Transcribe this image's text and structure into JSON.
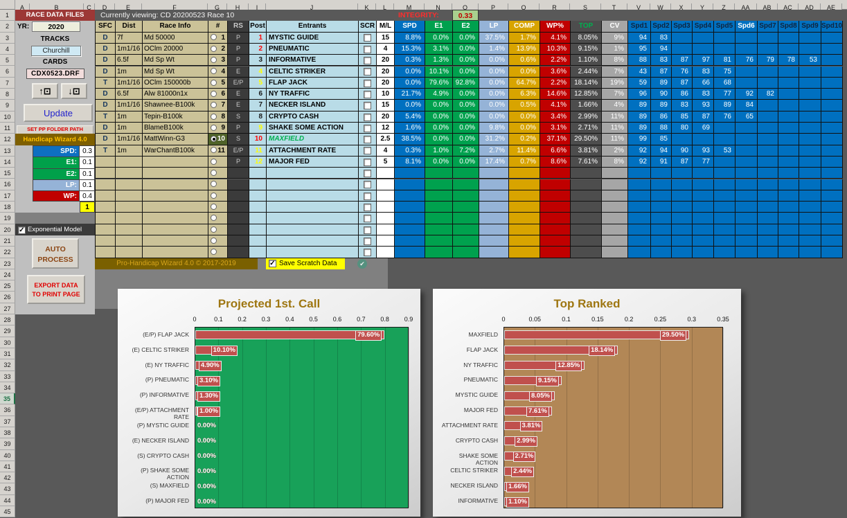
{
  "sheet": {
    "column_letters": [
      "A",
      "B",
      "C",
      "D",
      "E",
      "F",
      "G",
      "H",
      "I",
      "J",
      "K",
      "L",
      "M",
      "N",
      "O",
      "P",
      "Q",
      "R",
      "S",
      "T",
      "V",
      "W",
      "X",
      "Y",
      "Z",
      "AA",
      "AB",
      "AC",
      "AD",
      "AE"
    ],
    "row_count": 45,
    "active_row": 35
  },
  "left_panel": {
    "title": "RACE DATA FILES",
    "yr_label": "YR:",
    "yr_value": "2020",
    "tracks_label": "TRACKS",
    "track_value": "Churchill",
    "cards_label": "CARDS",
    "card_value": "CDX0523.DRF",
    "up_button": "↑⊡",
    "down_button": "↓⊡",
    "update_button": "Update",
    "set_pp_button": "SET PP FOLDER PATH",
    "wizard_title": "Handicap Wizard 4.0",
    "weights": [
      {
        "label": "SPD:",
        "value": "0.3",
        "color": "#0E6FC1"
      },
      {
        "label": "E1:",
        "value": "0.1",
        "color": "#00A04A"
      },
      {
        "label": "E2:",
        "value": "0.1",
        "color": "#00A04A"
      },
      {
        "label": "LP:",
        "value": "0.1",
        "color": "#95B3D7"
      },
      {
        "label": "WP:",
        "value": "0.4",
        "color": "#C00000"
      }
    ],
    "weights_total": "1",
    "exponential_label": "Exponential Model",
    "exponential_checked": true,
    "auto_process_line1": "AUTO",
    "auto_process_line2": "PROCESS",
    "export_line1": "EXPORT DATA",
    "export_line2": "TO PRINT PAGE"
  },
  "viewing_bar": {
    "text": "Currently viewing: CD 20200523 Race 10",
    "integrity_label": "INTEGRITY:",
    "integrity_value": "0.33"
  },
  "race_table": {
    "headers": [
      "SFC",
      "Dist",
      "Race Info",
      "#"
    ],
    "rows": [
      {
        "sfc": "D",
        "dist": "7f",
        "info": "Md 50000",
        "num": "1",
        "selected": false
      },
      {
        "sfc": "D",
        "dist": "1m1/16",
        "info": "OClm 20000",
        "num": "2",
        "selected": false
      },
      {
        "sfc": "D",
        "dist": "6.5f",
        "info": "Md Sp Wt",
        "num": "3",
        "selected": false
      },
      {
        "sfc": "D",
        "dist": "1m",
        "info": "Md Sp Wt",
        "num": "4",
        "selected": false
      },
      {
        "sfc": "T",
        "dist": "1m1/16",
        "info": "OClm 150000b",
        "num": "5",
        "selected": false
      },
      {
        "sfc": "D",
        "dist": "6.5f",
        "info": "Alw 81000n1x",
        "num": "6",
        "selected": false
      },
      {
        "sfc": "D",
        "dist": "1m1/16",
        "info": "Shawnee-B100k",
        "num": "7",
        "selected": false
      },
      {
        "sfc": "T",
        "dist": "1m",
        "info": "Tepin-B100k",
        "num": "8",
        "selected": false
      },
      {
        "sfc": "D",
        "dist": "1m",
        "info": "BlameB100k",
        "num": "9",
        "selected": false
      },
      {
        "sfc": "D",
        "dist": "1m1/16",
        "info": "MattWinn-G3",
        "num": "10",
        "selected": true
      },
      {
        "sfc": "T",
        "dist": "1m",
        "info": "WarChantB100k",
        "num": "11",
        "selected": false
      }
    ]
  },
  "entrant_table": {
    "headers": {
      "rs": "RS",
      "post": "Post",
      "name": "Entrants",
      "scr": "SCR",
      "ml": "M/L",
      "spd": "SPD",
      "e1": "E1",
      "e2": "E2",
      "lp": "LP",
      "comp": "COMP",
      "wp": "WP%",
      "top": "TOP",
      "cv": "CV"
    },
    "spd_headers": [
      "Spd1",
      "Spd2",
      "Spd3",
      "Spd4",
      "Spd5",
      "Spd6",
      "Spd7",
      "Spd8",
      "Spd9",
      "Spd10"
    ],
    "rows": [
      {
        "rs": "P",
        "post": "1",
        "post_color": "#FF0000",
        "name": "MYSTIC GUIDE",
        "ml": "15",
        "spd": "8.8%",
        "e1": "0.0%",
        "e2": "0.0%",
        "lp": "37.5%",
        "comp": "1.7%",
        "wp": "4.1%",
        "top": "8.05%",
        "cv": "9%",
        "spds": [
          "94",
          "83"
        ]
      },
      {
        "rs": "P",
        "post": "2",
        "post_color": "#FF0000",
        "name": "PNEUMATIC",
        "ml": "4",
        "spd": "15.3%",
        "e1": "3.1%",
        "e2": "0.0%",
        "lp": "1.4%",
        "comp": "13.9%",
        "wp": "10.3%",
        "top": "9.15%",
        "cv": "1%",
        "spds": [
          "95",
          "94"
        ]
      },
      {
        "rs": "P",
        "post": "3",
        "post_color": "#1A1A1A",
        "name": "INFORMATIVE",
        "ml": "20",
        "spd": "0.3%",
        "e1": "1.3%",
        "e2": "0.0%",
        "lp": "0.0%",
        "comp": "0.6%",
        "wp": "2.2%",
        "top": "1.10%",
        "cv": "8%",
        "spds": [
          "88",
          "83",
          "87",
          "97",
          "81",
          "76",
          "79",
          "78",
          "53"
        ]
      },
      {
        "rs": "E",
        "post": "4",
        "post_color": "#FFFF00",
        "name": "CELTIC STRIKER",
        "ml": "20",
        "spd": "0.0%",
        "e1": "10.1%",
        "e2": "0.0%",
        "lp": "0.0%",
        "comp": "0.0%",
        "wp": "3.6%",
        "top": "2.44%",
        "cv": "7%",
        "spds": [
          "43",
          "87",
          "76",
          "83",
          "75"
        ]
      },
      {
        "rs": "E/P",
        "post": "5",
        "post_color": "#FFFF00",
        "name": "FLAP JACK",
        "ml": "20",
        "spd": "0.0%",
        "e1": "79.6%",
        "e2": "92.8%",
        "lp": "0.0%",
        "comp": "64.7%",
        "wp": "2.2%",
        "top": "18.14%",
        "cv": "19%",
        "spds": [
          "59",
          "89",
          "87",
          "66",
          "68"
        ]
      },
      {
        "rs": "E",
        "post": "6",
        "post_color": "#1A1A1A",
        "name": "NY TRAFFIC",
        "ml": "10",
        "spd": "21.7%",
        "e1": "4.9%",
        "e2": "0.0%",
        "lp": "0.0%",
        "comp": "6.3%",
        "wp": "14.6%",
        "top": "12.85%",
        "cv": "7%",
        "spds": [
          "96",
          "90",
          "86",
          "83",
          "77",
          "92",
          "82"
        ]
      },
      {
        "rs": "E",
        "post": "7",
        "post_color": "#1A1A1A",
        "name": "NECKER ISLAND",
        "ml": "15",
        "spd": "0.0%",
        "e1": "0.0%",
        "e2": "0.0%",
        "lp": "0.0%",
        "comp": "0.5%",
        "wp": "4.1%",
        "top": "1.66%",
        "cv": "4%",
        "spds": [
          "89",
          "89",
          "83",
          "93",
          "89",
          "84"
        ]
      },
      {
        "rs": "S",
        "post": "8",
        "post_color": "#1A1A1A",
        "name": "CRYPTO CASH",
        "ml": "20",
        "spd": "5.4%",
        "e1": "0.0%",
        "e2": "0.0%",
        "lp": "0.0%",
        "comp": "0.0%",
        "wp": "3.4%",
        "top": "2.99%",
        "cv": "11%",
        "spds": [
          "89",
          "86",
          "85",
          "87",
          "76",
          "65"
        ]
      },
      {
        "rs": "P",
        "post": "9",
        "post_color": "#FFFF00",
        "name": "SHAKE SOME ACTION",
        "ml": "12",
        "spd": "1.6%",
        "e1": "0.0%",
        "e2": "0.0%",
        "lp": "9.8%",
        "comp": "0.0%",
        "wp": "3.1%",
        "top": "2.71%",
        "cv": "11%",
        "spds": [
          "89",
          "88",
          "80",
          "69"
        ]
      },
      {
        "rs": "S",
        "post": "10",
        "post_color": "#FF0000",
        "name": "MAXFIELD",
        "name_color": "#00B050",
        "name_italic": true,
        "ml": "2.5",
        "spd": "38.5%",
        "e1": "0.0%",
        "e2": "0.0%",
        "lp": "31.2%",
        "comp": "0.2%",
        "wp": "37.1%",
        "top": "29.50%",
        "cv": "11%",
        "spds": [
          "99",
          "85"
        ]
      },
      {
        "rs": "E/P",
        "post": "11",
        "post_color": "#FFFF00",
        "name": "ATTACHMENT RATE",
        "ml": "4",
        "spd": "0.3%",
        "e1": "1.0%",
        "e2": "7.2%",
        "lp": "2.7%",
        "comp": "11.4%",
        "wp": "6.6%",
        "top": "3.81%",
        "cv": "2%",
        "spds": [
          "92",
          "94",
          "90",
          "93",
          "53"
        ]
      },
      {
        "rs": "P",
        "post": "12",
        "post_color": "#FFFF00",
        "name": "MAJOR FED",
        "ml": "5",
        "spd": "8.1%",
        "e1": "0.0%",
        "e2": "0.0%",
        "lp": "17.4%",
        "comp": "0.7%",
        "wp": "8.6%",
        "top": "7.61%",
        "cv": "8%",
        "spds": [
          "92",
          "91",
          "87",
          "77"
        ]
      }
    ],
    "empty_rows": 8
  },
  "footer": {
    "brand": "Pro-Handicap Wizard 4.0 © 2017-2019",
    "save_scratch": "Save Scratch Data",
    "save_scratch_checked": true
  },
  "chart_data": [
    {
      "type": "bar",
      "orientation": "horizontal",
      "title": "Projected 1st. Call",
      "categories": [
        "(E/P) FLAP JACK",
        "(E) CELTIC STRIKER",
        "(E) NY TRAFFIC",
        "(P) PNEUMATIC",
        "(P) INFORMATIVE",
        "(E/P) ATTACHMENT RATE",
        "(P) MYSTIC GUIDE",
        "(E) NECKER ISLAND",
        "(S) CRYPTO CASH",
        "(P) SHAKE SOME ACTION",
        "(S) MAXFIELD",
        "(P) MAJOR FED"
      ],
      "values": [
        0.796,
        0.101,
        0.049,
        0.031,
        0.013,
        0.01,
        0,
        0,
        0,
        0,
        0,
        0
      ],
      "labels": [
        "79.60%",
        "10.10%",
        "4.90%",
        "3.10%",
        "1.30%",
        "1.00%",
        "0.00%",
        "0.00%",
        "0.00%",
        "0.00%",
        "0.00%",
        "0.00%"
      ],
      "xlim": [
        0,
        0.9
      ],
      "xticks": [
        "0",
        "0.1",
        "0.2",
        "0.3",
        "0.4",
        "0.5",
        "0.6",
        "0.7",
        "0.8",
        "0.9"
      ],
      "grid": true,
      "legend_position": "none",
      "plot_bg": "#18A159",
      "bar_color": "#C0504D"
    },
    {
      "type": "bar",
      "orientation": "horizontal",
      "title": "Top Ranked",
      "categories": [
        "MAXFIELD",
        "FLAP JACK",
        "NY TRAFFIC",
        "PNEUMATIC",
        "MYSTIC GUIDE",
        "MAJOR FED",
        "ATTACHMENT RATE",
        "CRYPTO CASH",
        "SHAKE SOME ACTION",
        "CELTIC STRIKER",
        "NECKER ISLAND",
        "INFORMATIVE"
      ],
      "values": [
        0.295,
        0.1814,
        0.1285,
        0.0915,
        0.0805,
        0.0761,
        0.0381,
        0.0299,
        0.0271,
        0.0244,
        0.0166,
        0.011
      ],
      "labels": [
        "29.50%",
        "18.14%",
        "12.85%",
        "9.15%",
        "8.05%",
        "7.61%",
        "3.81%",
        "2.99%",
        "2.71%",
        "2.44%",
        "1.66%",
        "1.10%"
      ],
      "xlim": [
        0,
        0.35
      ],
      "xticks": [
        "0",
        "0.05",
        "0.1",
        "0.15",
        "0.2",
        "0.25",
        "0.3",
        "0.35"
      ],
      "grid": true,
      "legend_position": "none",
      "plot_bg": "#B28756",
      "bar_color": "#C0504D"
    }
  ]
}
